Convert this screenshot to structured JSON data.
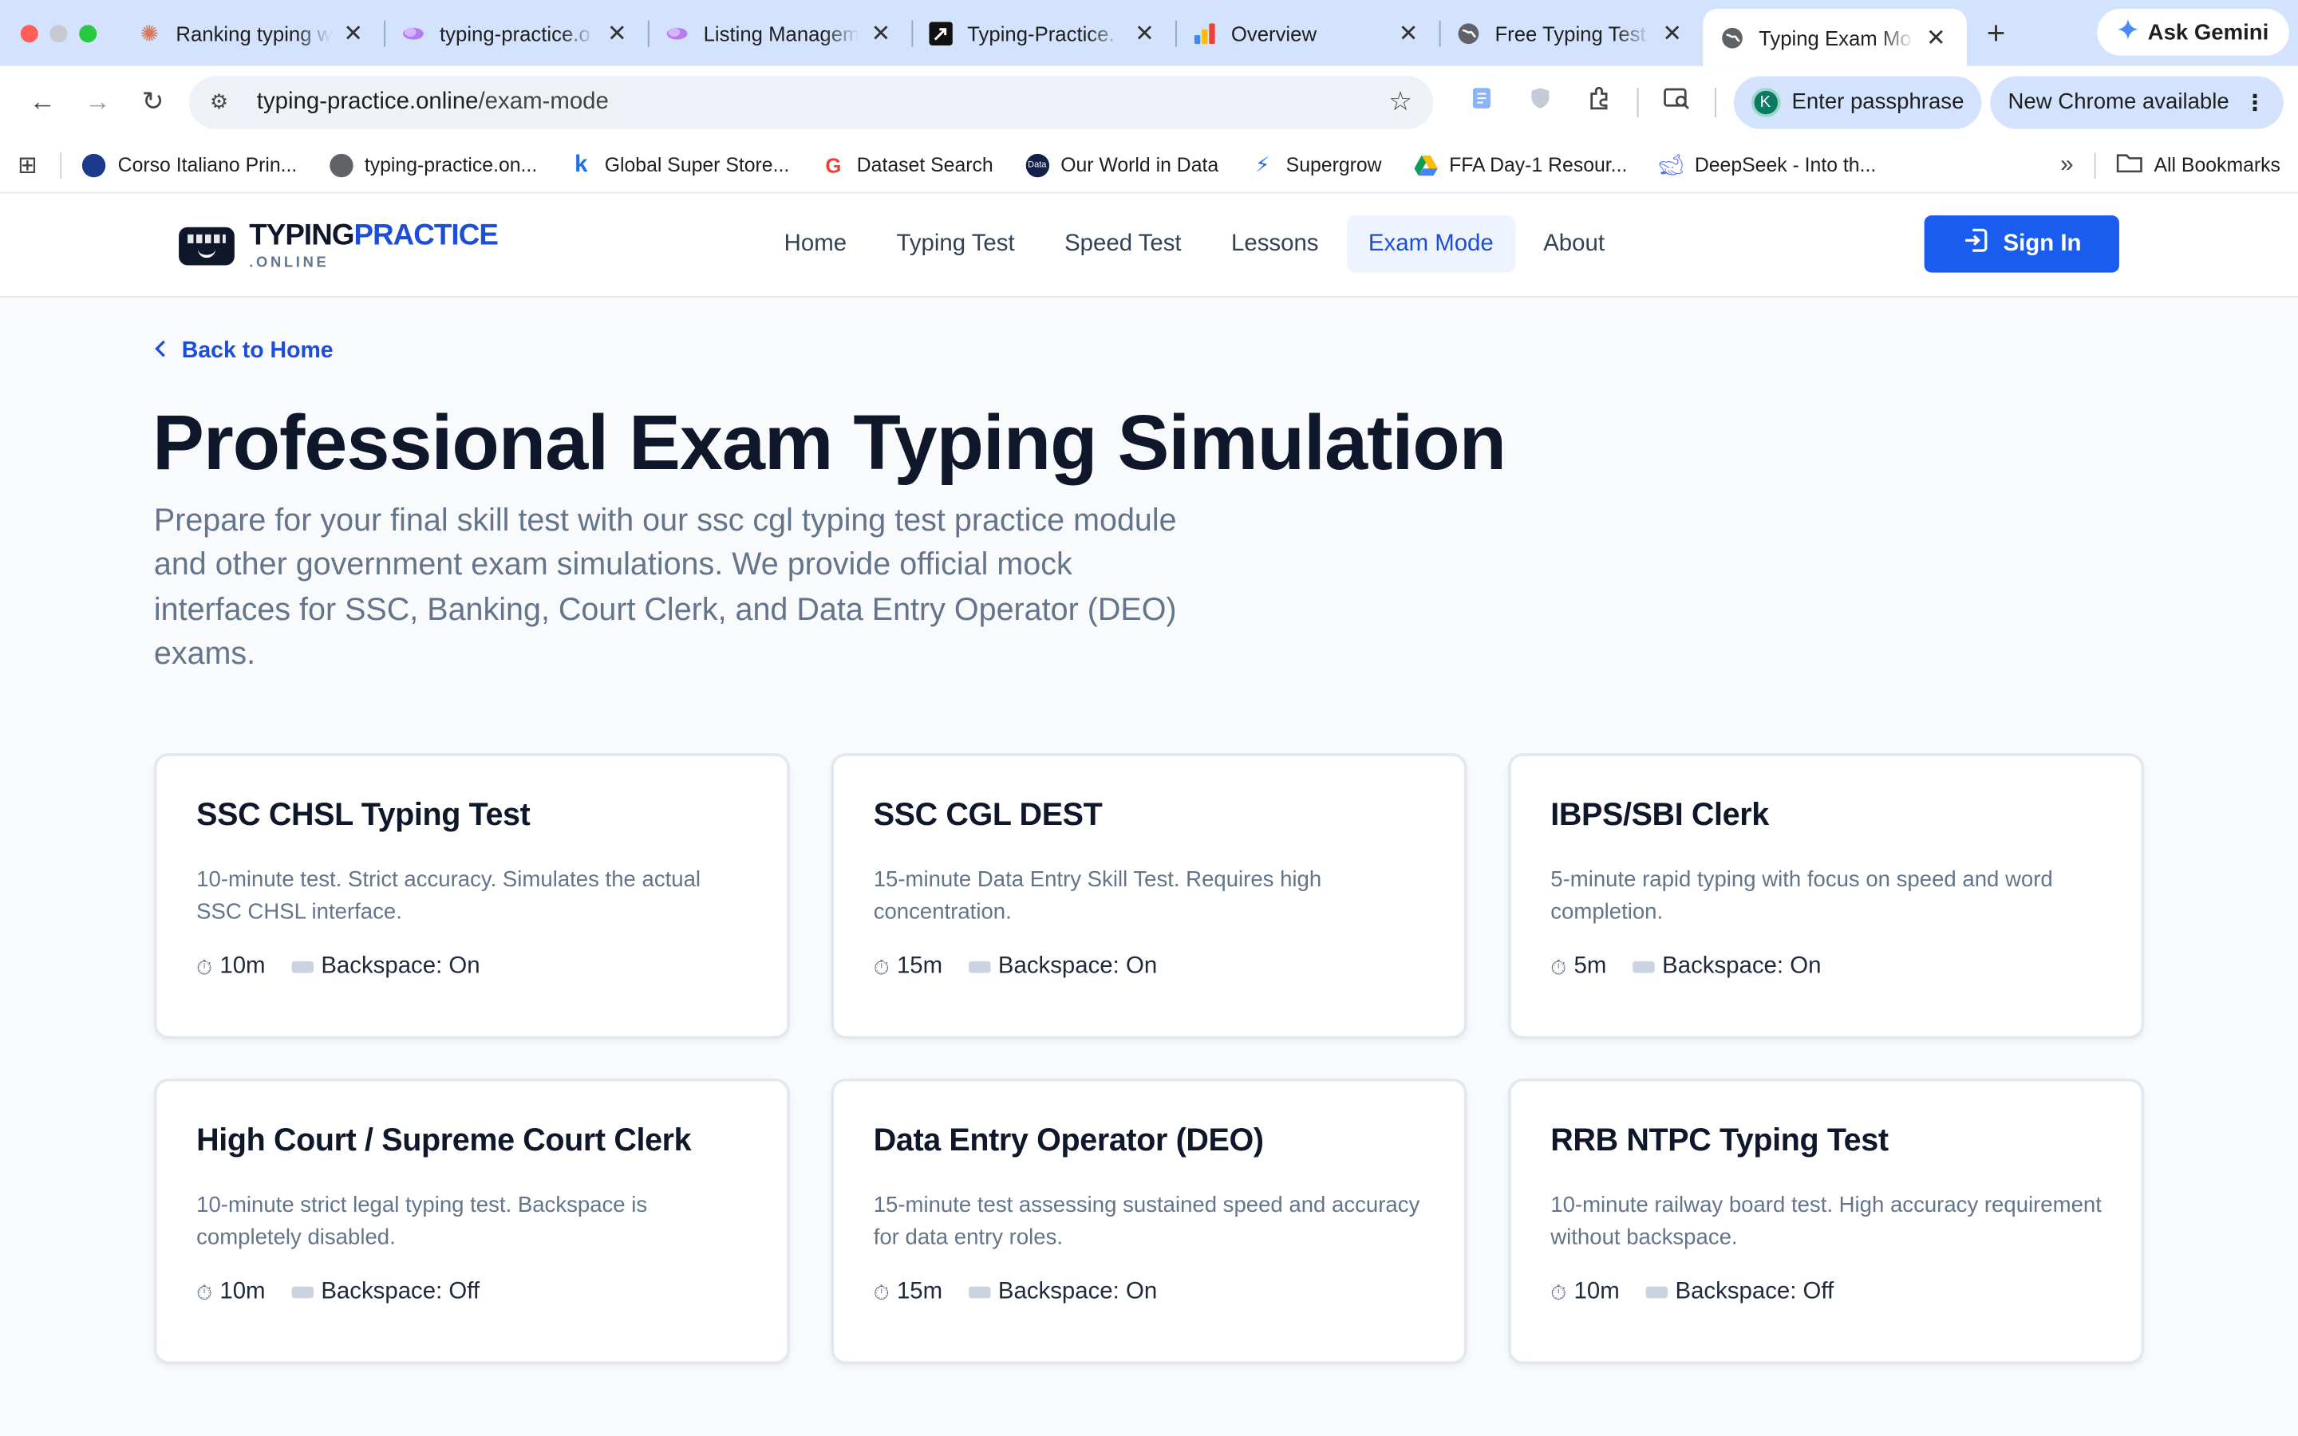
{
  "browser": {
    "tabs": [
      {
        "title": "Ranking typing w",
        "icon": "claude-icon"
      },
      {
        "title": "typing-practice.o",
        "icon": "lovable-icon"
      },
      {
        "title": "Listing Managem",
        "icon": "lovable-icon"
      },
      {
        "title": "Typing-Practice.",
        "icon": "cursor-icon"
      },
      {
        "title": "Overview",
        "icon": "analytics-icon"
      },
      {
        "title": "Free Typing Test",
        "icon": "globe-icon"
      },
      {
        "title": "Typing Exam Mo",
        "icon": "globe-icon"
      }
    ],
    "ask_gemini": "Ask Gemini",
    "url_host": "typing-practice.online",
    "url_path": "/exam-mode",
    "passphrase_label": "Enter passphrase",
    "profile_initial": "K",
    "update_label": "New Chrome available",
    "bookmarks": [
      {
        "label": "Corso Italiano Prin...",
        "icon": "globe-icon"
      },
      {
        "label": "typing-practice.on...",
        "icon": "globe-icon"
      },
      {
        "label": "Global Super Store...",
        "icon": "k-icon"
      },
      {
        "label": "Dataset Search",
        "icon": "google-icon"
      },
      {
        "label": "Our World in Data",
        "icon": "owid-icon"
      },
      {
        "label": "Supergrow",
        "icon": "supergrow-icon"
      },
      {
        "label": "FFA Day-1 Resour...",
        "icon": "drive-icon"
      },
      {
        "label": "DeepSeek - Into th...",
        "icon": "deepseek-icon"
      }
    ],
    "all_bookmarks": "All Bookmarks"
  },
  "site": {
    "logo_main": "TYPING",
    "logo_accent": "PRACTICE",
    "logo_sub": ".ONLINE",
    "nav": [
      "Home",
      "Typing Test",
      "Speed Test",
      "Lessons",
      "Exam Mode",
      "About"
    ],
    "active_nav": "Exam Mode",
    "sign_in": "Sign In"
  },
  "main": {
    "back_label": "Back to Home",
    "title": "Professional Exam Typing Simulation",
    "description": "Prepare for your final skill test with our ssc cgl typing test practice module and other government exam simulations. We provide official mock interfaces for SSC, Banking, Court Clerk, and Data Entry Operator (DEO) exams.",
    "cards": [
      {
        "title": "SSC CHSL Typing Test",
        "desc": "10-minute test. Strict accuracy. Simulates the actual SSC CHSL interface.",
        "duration": "10m",
        "backspace": "Backspace: On"
      },
      {
        "title": "SSC CGL DEST",
        "desc": "15-minute Data Entry Skill Test. Requires high concentration.",
        "duration": "15m",
        "backspace": "Backspace: On"
      },
      {
        "title": "IBPS/SBI Clerk",
        "desc": "5-minute rapid typing with focus on speed and word completion.",
        "duration": "5m",
        "backspace": "Backspace: On"
      },
      {
        "title": "High Court / Supreme Court Clerk",
        "desc": "10-minute strict legal typing test. Backspace is completely disabled.",
        "duration": "10m",
        "backspace": "Backspace: Off"
      },
      {
        "title": "Data Entry Operator (DEO)",
        "desc": "15-minute test assessing sustained speed and accuracy for data entry roles.",
        "duration": "15m",
        "backspace": "Backspace: On"
      },
      {
        "title": "RRB NTPC Typing Test",
        "desc": "10-minute railway board test. High accuracy requirement without backspace.",
        "duration": "10m",
        "backspace": "Backspace: Off"
      }
    ]
  },
  "colors": {
    "accent": "#1a5cf0",
    "tab_strip": "#d3e3fd",
    "page_bg": "#f8fafc"
  }
}
